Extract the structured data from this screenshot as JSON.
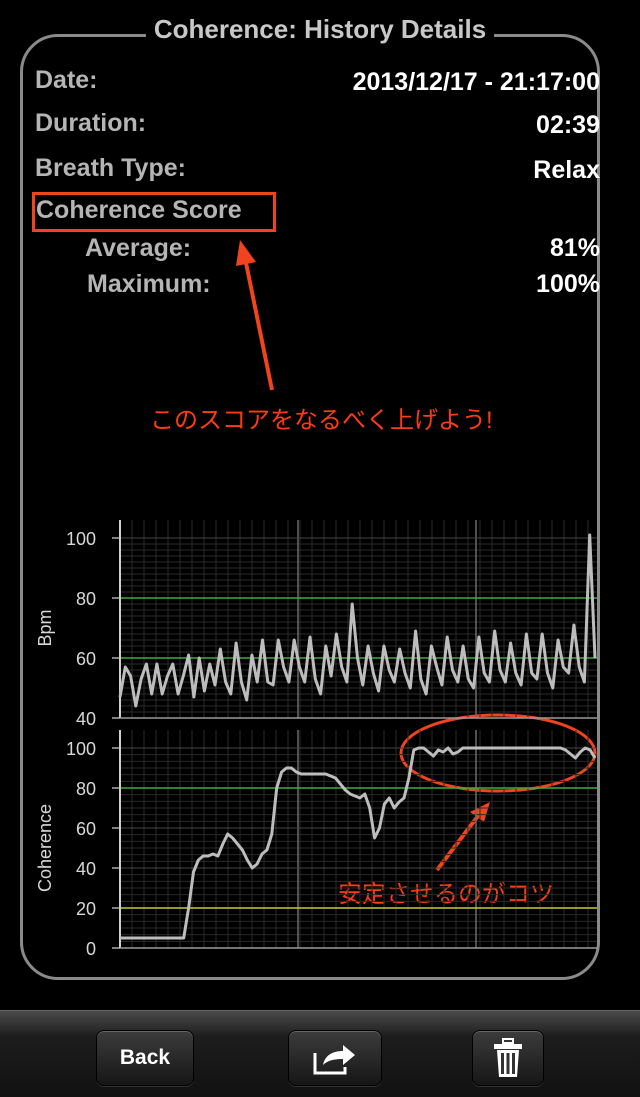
{
  "title": "Coherence: History Details",
  "details": {
    "date_label": "Date:",
    "date_value": "2013/12/17 - 21:17:00",
    "duration_label": "Duration:",
    "duration_value": "02:39",
    "breath_label": "Breath Type:",
    "breath_value": "Relax",
    "score_label": "Coherence Score",
    "average_label": "Average:",
    "average_value": "81%",
    "maximum_label": "Maximum:",
    "maximum_value": "100%"
  },
  "annotations": {
    "score_note": "このスコアをなるべく上げよう!",
    "stable_note": "安定させるのがコツ"
  },
  "colors": {
    "accent_red": "#f0431e",
    "graph_line": "#bdbdbd",
    "green_line": "#3cae3c",
    "yellow_line": "#c9c93a"
  },
  "toolbar": {
    "back_label": "Back",
    "share_icon": "share-arrow-icon",
    "delete_icon": "trash-icon"
  },
  "chart_data": [
    {
      "type": "line",
      "ylabel": "Bpm",
      "ylim": [
        40,
        100
      ],
      "yticks": [
        "100",
        "80",
        "60",
        "40"
      ],
      "reference_lines": {
        "green": [
          80,
          60
        ]
      },
      "values": [
        47,
        57,
        54,
        44,
        53,
        58,
        48,
        58,
        48,
        54,
        58,
        48,
        54,
        61,
        47,
        60,
        49,
        58,
        51,
        63,
        52,
        48,
        65,
        52,
        46,
        61,
        52,
        66,
        52,
        51,
        66,
        57,
        52,
        66,
        57,
        52,
        67,
        53,
        48,
        64,
        54,
        68,
        57,
        52,
        78,
        60,
        51,
        64,
        55,
        49,
        64,
        56,
        52,
        63,
        55,
        50,
        69,
        53,
        48,
        64,
        57,
        51,
        67,
        56,
        52,
        64,
        53,
        50,
        67,
        55,
        52,
        69,
        56,
        52,
        65,
        55,
        51,
        68,
        55,
        53,
        68,
        55,
        50,
        66,
        57,
        55,
        71,
        57,
        52,
        101,
        60
      ]
    },
    {
      "type": "line",
      "ylabel": "Coherence",
      "ylim": [
        0,
        100
      ],
      "yticks": [
        "100",
        "80",
        "60",
        "40",
        "20",
        "0"
      ],
      "reference_lines": {
        "green": 80,
        "yellow": 20
      },
      "values": [
        5,
        5,
        5,
        5,
        5,
        5,
        5,
        5,
        5,
        5,
        5,
        5,
        5,
        5,
        20,
        38,
        44,
        46,
        46,
        47,
        46,
        52,
        57,
        55,
        52,
        49,
        44,
        40,
        42,
        47,
        49,
        57,
        80,
        88,
        90,
        90,
        88,
        87,
        87,
        87,
        87,
        87,
        87,
        86,
        85,
        82,
        79,
        77,
        76,
        75,
        77,
        70,
        55,
        60,
        72,
        75,
        70,
        73,
        75,
        85,
        99,
        100,
        100,
        98,
        96,
        99,
        98,
        100,
        97,
        98,
        100,
        100,
        100,
        100,
        100,
        100,
        100,
        100,
        100,
        100,
        100,
        100,
        100,
        100,
        100,
        100,
        100,
        100,
        100,
        100,
        100,
        99,
        97,
        95,
        98,
        100,
        99,
        95
      ]
    }
  ]
}
